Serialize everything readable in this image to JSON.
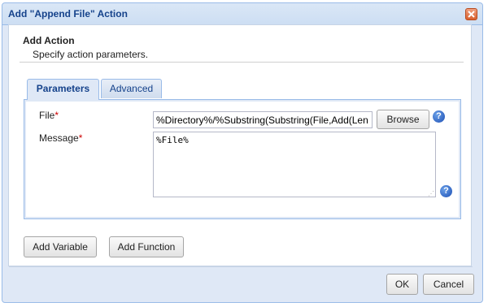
{
  "dialog": {
    "title": "Add \"Append File\" Action"
  },
  "header": {
    "title": "Add Action",
    "subtitle": "Specify action parameters."
  },
  "tabs": [
    {
      "label": "Parameters",
      "active": true
    },
    {
      "label": "Advanced",
      "active": false
    }
  ],
  "fields": {
    "file": {
      "label": "File",
      "required_mark": "*",
      "value": "%Directory%/%Substring(Substring(File,Add(Len"
    },
    "message": {
      "label": "Message",
      "required_mark": "*",
      "value": "%File%"
    }
  },
  "buttons": {
    "browse": "Browse",
    "add_variable": "Add Variable",
    "add_function": "Add Function",
    "ok": "OK",
    "cancel": "Cancel"
  },
  "icons": {
    "close": "close-icon",
    "help": "help-icon",
    "help_glyph": "?"
  },
  "colors": {
    "title_text": "#15428b",
    "close_button": "#d8602e",
    "help_icon": "#1d4fb4",
    "required": "#cc0000"
  }
}
